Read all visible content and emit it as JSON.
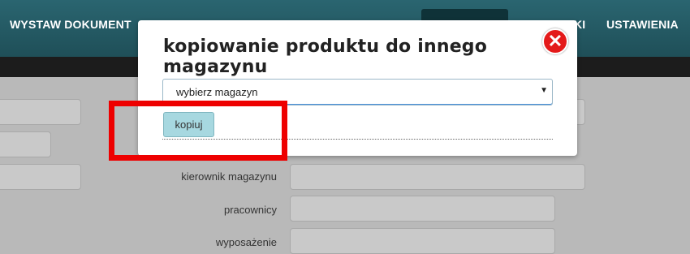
{
  "nav": {
    "items": [
      "WYSTAW DOKUMENT",
      "KI",
      "USTAWIENIA"
    ],
    "active_tab_label": ""
  },
  "form": {
    "labels": [
      "kierownik magazynu",
      "pracownicy",
      "wyposażenie"
    ]
  },
  "modal": {
    "title": "kopiowanie produktu do innego magazynu",
    "close_symbol": "✕",
    "select": {
      "value": "wybierz magazyn",
      "arrow": "▼"
    },
    "copy_button": "kopiuj"
  },
  "colors": {
    "nav_bg": "#1f4f58",
    "nav_active": "#0f3238",
    "close_red": "#e41a1a",
    "highlight_red": "#ee0000",
    "copy_button_bg": "#a7d8e0"
  },
  "icons": {
    "close": "close-circle-icon",
    "dropdown": "chevron-down-icon"
  }
}
